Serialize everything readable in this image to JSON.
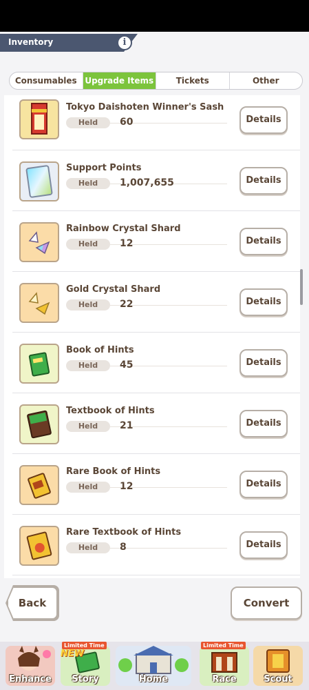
{
  "header": {
    "title": "Inventory",
    "info_icon": "info-icon",
    "info_label": "i"
  },
  "tabs": [
    {
      "label": "Consumables",
      "active": false
    },
    {
      "label": "Upgrade Items",
      "active": true
    },
    {
      "label": "Tickets",
      "active": false
    },
    {
      "label": "Other",
      "active": false
    }
  ],
  "held_label": "Held",
  "details_label": "Details",
  "items": [
    {
      "name": "Tokyo Daishoten Winner's Sash",
      "held": "60",
      "icon": "sash-icon"
    },
    {
      "name": "Support Points",
      "held": "1,007,655",
      "icon": "support-points-card-icon"
    },
    {
      "name": "Rainbow Crystal Shard",
      "held": "12",
      "icon": "rainbow-crystal-icon"
    },
    {
      "name": "Gold Crystal Shard",
      "held": "22",
      "icon": "gold-crystal-icon"
    },
    {
      "name": "Book of Hints",
      "held": "45",
      "icon": "green-book-icon"
    },
    {
      "name": "Textbook of Hints",
      "held": "21",
      "icon": "textbook-icon"
    },
    {
      "name": "Rare Book of Hints",
      "held": "12",
      "icon": "rare-book-icon"
    },
    {
      "name": "Rare Textbook of Hints",
      "held": "8",
      "icon": "rare-textbook-icon"
    }
  ],
  "footer": {
    "back_label": "Back",
    "convert_label": "Convert"
  },
  "nav": [
    {
      "label": "Enhance",
      "icon": "horse-girl-icon",
      "badge": ""
    },
    {
      "label": "Story",
      "icon": "story-book-icon",
      "badge": "Limited Time",
      "new": "NEW"
    },
    {
      "label": "Home",
      "icon": "school-building-icon",
      "badge": ""
    },
    {
      "label": "Race",
      "icon": "race-gate-icon",
      "badge": "Limited Time"
    },
    {
      "label": "Scout",
      "icon": "scout-icon",
      "badge": ""
    }
  ],
  "colors": {
    "accent_green": "#7cc43c",
    "header_slate": "#4b5770",
    "text_brown": "#5a4636"
  }
}
